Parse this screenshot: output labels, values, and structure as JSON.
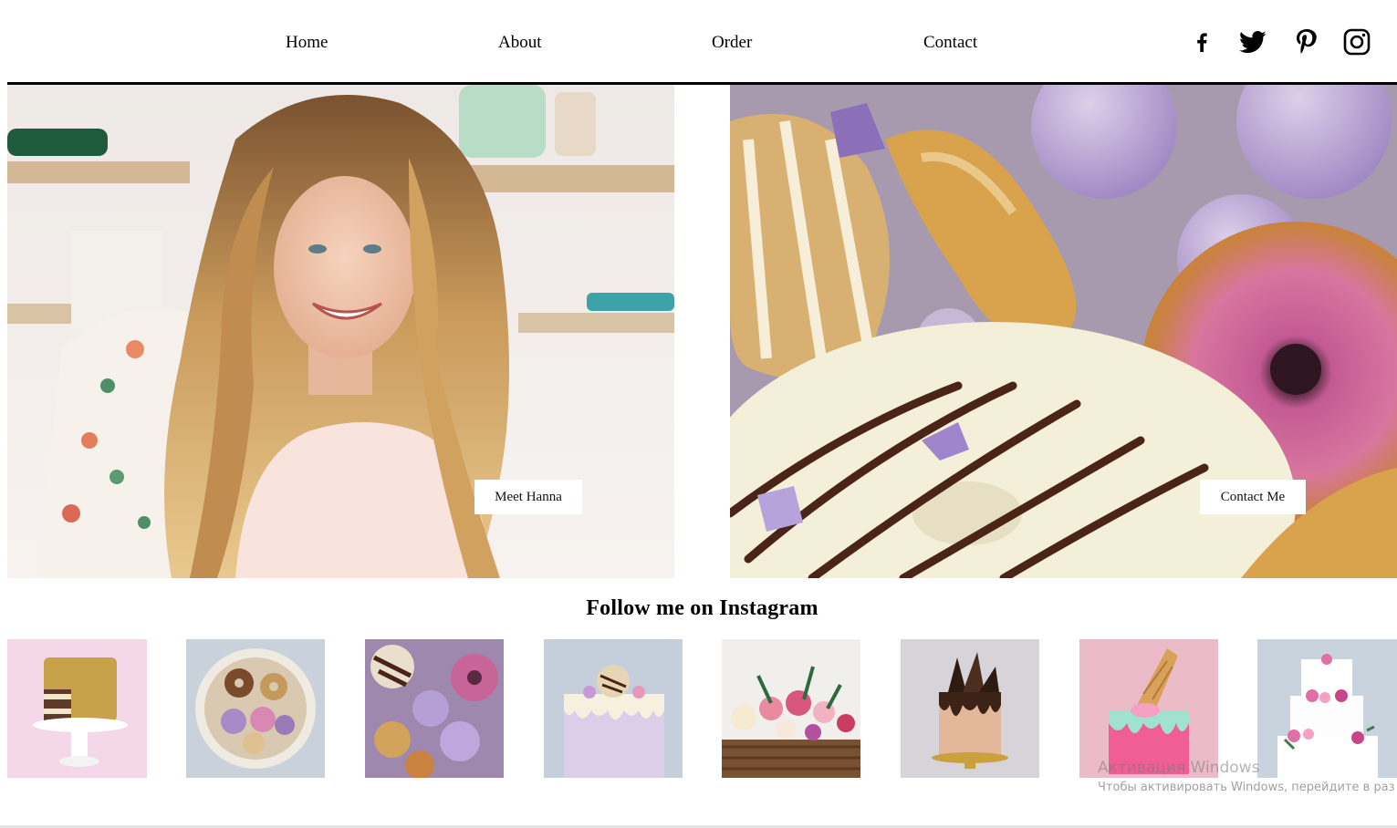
{
  "nav": {
    "home": "Home",
    "about": "About",
    "order": "Order",
    "contact": "Contact"
  },
  "social": [
    "facebook-icon",
    "twitter-icon",
    "pinterest-icon",
    "instagram-icon"
  ],
  "hero": {
    "left_button": "Meet Hanna",
    "right_button": "Contact Me"
  },
  "instagram": {
    "title": "Follow me on Instagram",
    "thumbnails": [
      "naked-cake",
      "donut-platter",
      "donuts-meringues",
      "drip-cake-donut",
      "flower-basket",
      "chocolate-shard-cake",
      "ice-cream-cone-cake",
      "floral-tier-cake"
    ]
  },
  "watermark": {
    "line1": "Активация Windows",
    "line2": "Чтобы активировать Windows, перейдите в раз"
  },
  "colors": {
    "accent": "#000000",
    "background": "#ffffff",
    "lavender": "#b79fd0",
    "pink": "#d7689f"
  }
}
